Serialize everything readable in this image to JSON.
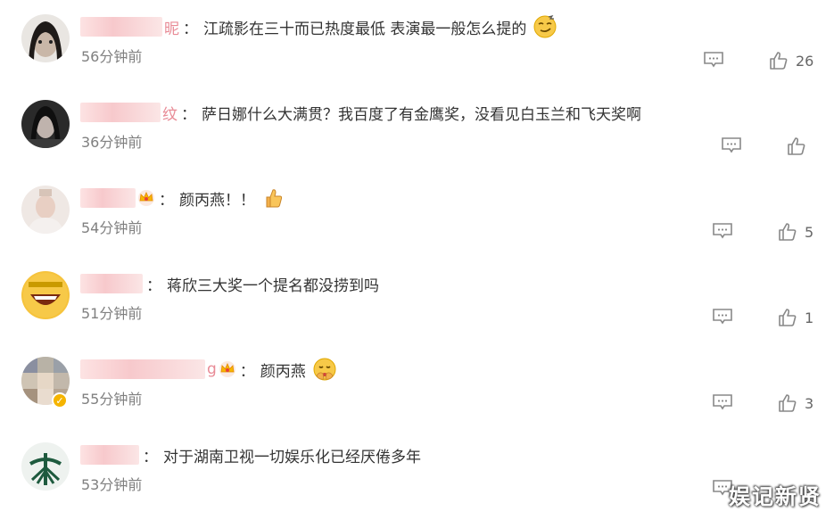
{
  "comments": [
    {
      "name_tail": "昵",
      "text": "江疏影在三十而已热度最低 表演最一般怎么提的",
      "time": "56分钟前",
      "likes": "26",
      "emoji": "smirk-face-icon",
      "crown": false,
      "verified": false
    },
    {
      "name_tail": "纹",
      "text": "萨日娜什么大满贯？我百度了有金鹰奖，没看见白玉兰和飞天奖啊",
      "time": "36分钟前",
      "likes": "",
      "emoji": "",
      "crown": false,
      "verified": false
    },
    {
      "name_tail": "",
      "text": "颜丙燕！！",
      "time": "54分钟前",
      "likes": "5",
      "emoji": "thumbs-up-emoji-icon",
      "crown": true,
      "verified": false
    },
    {
      "name_tail": "",
      "text": "蒋欣三大奖一个提名都没捞到吗",
      "time": "51分钟前",
      "likes": "1",
      "emoji": "",
      "crown": false,
      "verified": false
    },
    {
      "name_tail": "g",
      "text": "颜丙燕",
      "time": "55分钟前",
      "likes": "3",
      "emoji": "hush-face-icon",
      "crown": true,
      "verified": true
    },
    {
      "name_tail": "",
      "text": "对于湖南卫视一切娱乐化已经厌倦多年",
      "time": "53分钟前",
      "likes": "",
      "emoji": "",
      "crown": false,
      "verified": false
    }
  ],
  "watermark": "娱记新贤",
  "colors": {
    "text": "#333333",
    "time": "#808080",
    "icon": "#888888",
    "name_blur": "#f7c9cc",
    "name_tail": "#e88b96"
  }
}
